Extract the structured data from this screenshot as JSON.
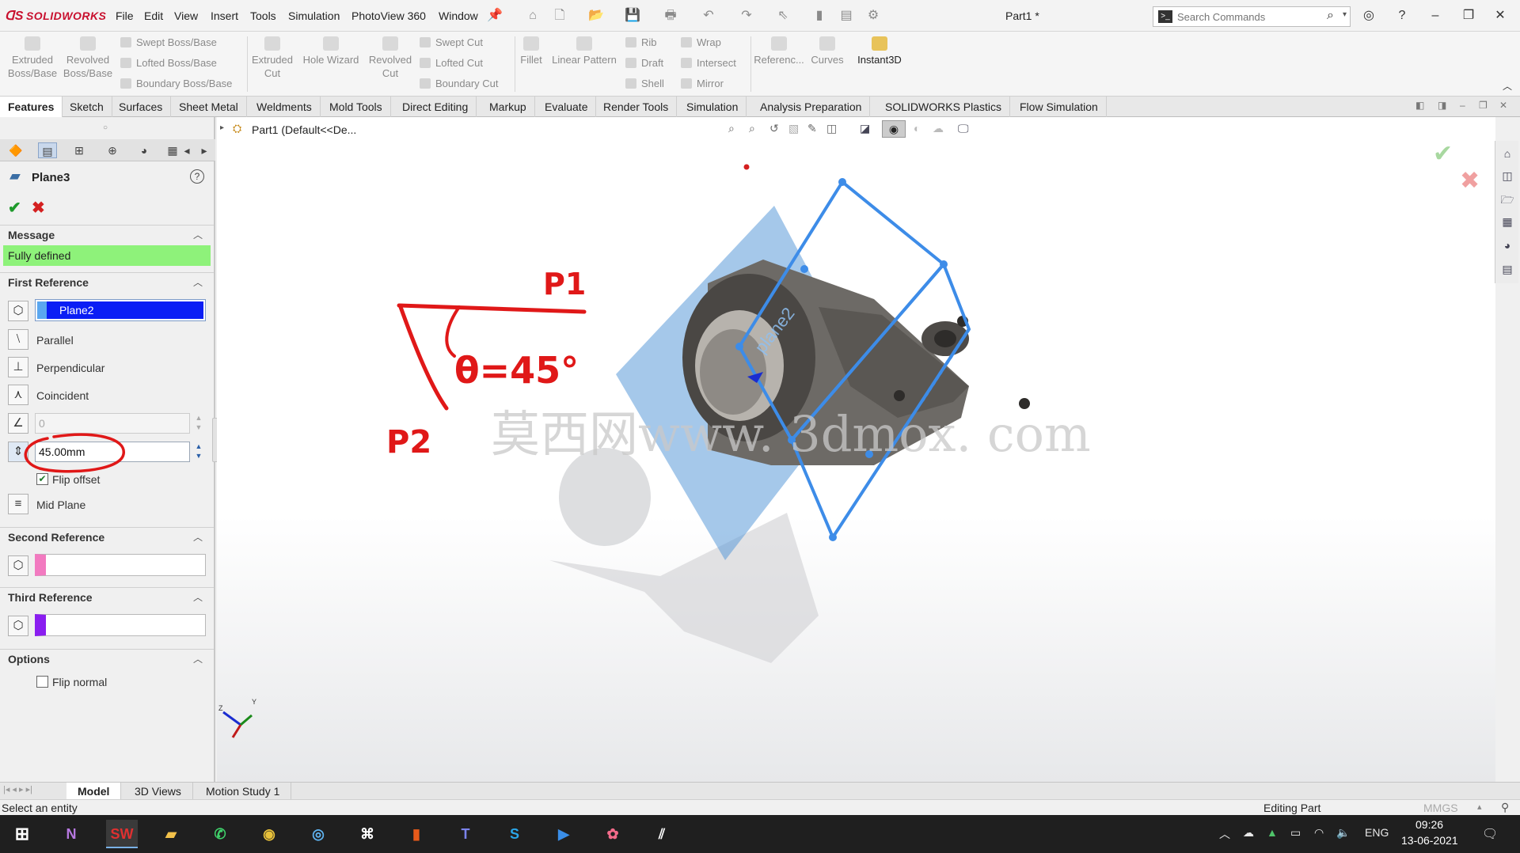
{
  "app": {
    "brand": "SOLIDWORKS",
    "doc_title": "Part1 *"
  },
  "menu": [
    "File",
    "Edit",
    "View",
    "Insert",
    "Tools",
    "Simulation",
    "PhotoView 360",
    "Window"
  ],
  "search": {
    "placeholder": "Search Commands"
  },
  "commands": {
    "extruded_boss": "Extruded Boss/Base",
    "revolved_boss": "Revolved Boss/Base",
    "swept_boss": "Swept Boss/Base",
    "lofted_boss": "Lofted Boss/Base",
    "boundary_boss": "Boundary Boss/Base",
    "extruded_cut": "Extruded Cut",
    "hole_wizard": "Hole Wizard",
    "revolved_cut": "Revolved Cut",
    "swept_cut": "Swept Cut",
    "lofted_cut": "Lofted Cut",
    "boundary_cut": "Boundary Cut",
    "fillet": "Fillet",
    "linear_pattern": "Linear Pattern",
    "rib": "Rib",
    "draft": "Draft",
    "shell": "Shell",
    "wrap": "Wrap",
    "intersect": "Intersect",
    "mirror": "Mirror",
    "reference": "Referenc...",
    "curves": "Curves",
    "instant3d": "Instant3D"
  },
  "tabs": [
    "Features",
    "Sketch",
    "Surfaces",
    "Sheet Metal",
    "Weldments",
    "Mold Tools",
    "Direct Editing",
    "Markup",
    "Evaluate",
    "Render Tools",
    "Simulation",
    "Analysis Preparation",
    "SOLIDWORKS Plastics",
    "Flow Simulation"
  ],
  "property_manager": {
    "title": "Plane3",
    "message_header": "Message",
    "message": "Fully defined",
    "first_ref_header": "First Reference",
    "first_ref_value": "Plane2",
    "parallel": "Parallel",
    "perpendicular": "Perpendicular",
    "coincident": "Coincident",
    "angle_value": "0",
    "offset_value": "45.00mm",
    "flip_offset": "Flip offset",
    "mid_plane": "Mid Plane",
    "second_ref_header": "Second Reference",
    "third_ref_header": "Third Reference",
    "options_header": "Options",
    "flip_normal": "Flip normal",
    "colors": {
      "message_bg": "#8ef27a",
      "selection_bg": "#0b1ef5",
      "second_ref": "#f27ac0",
      "third_ref": "#8a1ef0"
    }
  },
  "tree": {
    "node": "Part1  (Default<<De..."
  },
  "annotation": {
    "p1": "P1",
    "p2": "P2",
    "theta": "θ=45°",
    "plane_label": "plane2"
  },
  "watermark": "莫西网www. 3dmox. com",
  "bottom_tabs": [
    "Model",
    "3D Views",
    "Motion Study 1"
  ],
  "status": {
    "left": "Select an entity",
    "center": "Editing Part",
    "units": "MMGS"
  },
  "taskbar": {
    "lang": "ENG",
    "time": "09:26",
    "date": "13-06-2021"
  }
}
